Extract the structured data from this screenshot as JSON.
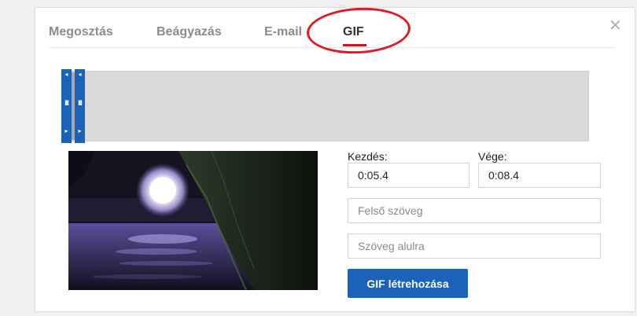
{
  "tabs": [
    {
      "label": "Megosztás"
    },
    {
      "label": "Beágyazás"
    },
    {
      "label": "E-mail"
    },
    {
      "label": "GIF"
    }
  ],
  "active_tab": "GIF",
  "close_icon": "close-icon",
  "trim": {
    "start_label": "Kezdés:",
    "start_value": "0:05.4",
    "end_label": "Vége:",
    "end_value": "0:08.4"
  },
  "text_fields": {
    "top_placeholder": "Felső szöveg",
    "bottom_placeholder": "Szöveg alulra"
  },
  "create_button": "GIF létrehozása",
  "colors": {
    "accent": "#1c62b9",
    "annotation": "#e01b22",
    "tab_active": "#cc181e"
  }
}
